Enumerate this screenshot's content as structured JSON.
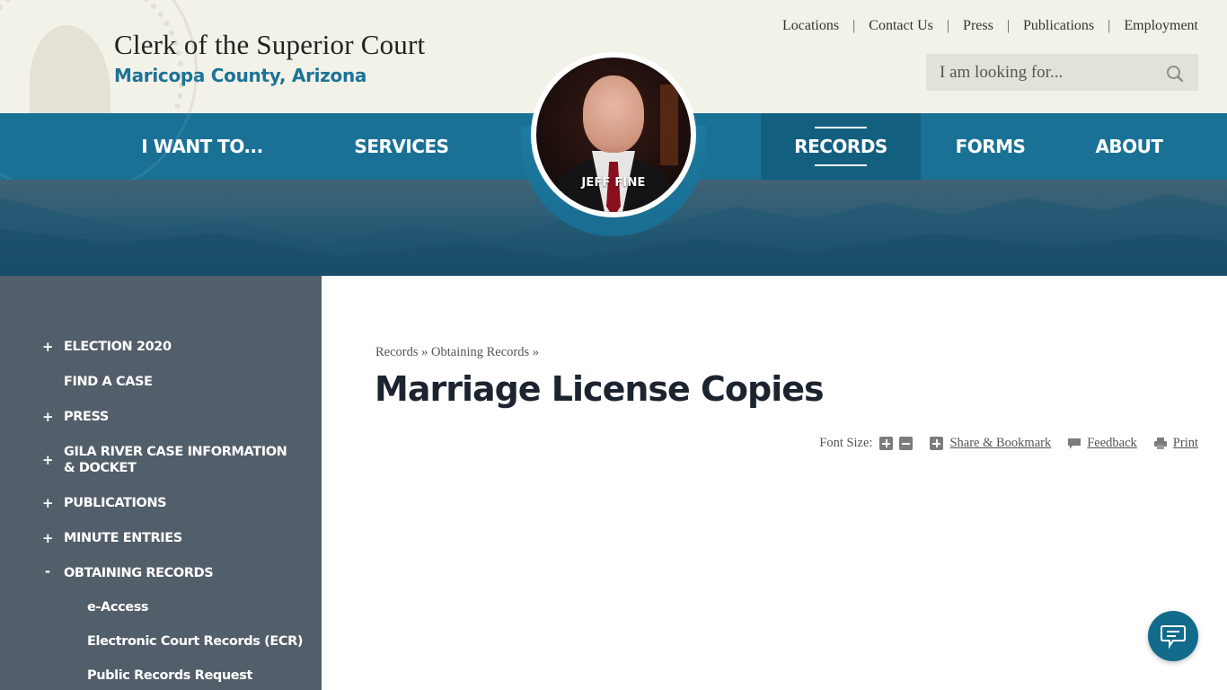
{
  "header": {
    "title": "Clerk of the Superior Court",
    "subtitle": "Maricopa County, Arizona",
    "utility_links": [
      "Locations",
      "Contact Us",
      "Press",
      "Publications",
      "Employment"
    ],
    "separator": "|",
    "search": {
      "placeholder": "I am looking for..."
    }
  },
  "nav": {
    "items": [
      {
        "label": "I WANT TO...",
        "active": false
      },
      {
        "label": "SERVICES",
        "active": false
      },
      {
        "label": "RECORDS",
        "active": true
      },
      {
        "label": "FORMS",
        "active": false
      },
      {
        "label": "ABOUT",
        "active": false
      }
    ],
    "portrait_name": "JEFF FINE"
  },
  "sidebar": {
    "items": [
      {
        "label": "ELECTION 2020",
        "toggle": "+"
      },
      {
        "label": "FIND A CASE",
        "toggle": ""
      },
      {
        "label": "PRESS",
        "toggle": "+"
      },
      {
        "label": "GILA RIVER CASE INFORMATION & DOCKET",
        "toggle": "+"
      },
      {
        "label": "PUBLICATIONS",
        "toggle": "+"
      },
      {
        "label": "MINUTE ENTRIES",
        "toggle": "+"
      },
      {
        "label": "OBTAINING RECORDS",
        "toggle": "-"
      }
    ],
    "subitems": [
      "e-Access",
      "Electronic Court Records (ECR)",
      "Public Records Request"
    ]
  },
  "main": {
    "breadcrumb": [
      "Records",
      "Obtaining Records"
    ],
    "breadcrumb_sep": "»",
    "title": "Marriage License Copies",
    "tools": {
      "font_size_label": "Font Size:",
      "share_label": "Share & Bookmark",
      "feedback_label": "Feedback",
      "print_label": "Print"
    }
  },
  "colors": {
    "brand_blue": "#1a7196",
    "nav_active": "#125f80",
    "sidebar_bg": "#525e69",
    "header_bg": "#f3f2e8",
    "subtitle_blue": "#1d7398"
  },
  "icons": {
    "search": "search-icon",
    "chat": "chat-icon",
    "font_increase": "plus-square-icon",
    "font_decrease": "minus-square-icon",
    "share": "plus-square-icon",
    "feedback": "speech-bubble-icon",
    "print": "printer-icon"
  }
}
